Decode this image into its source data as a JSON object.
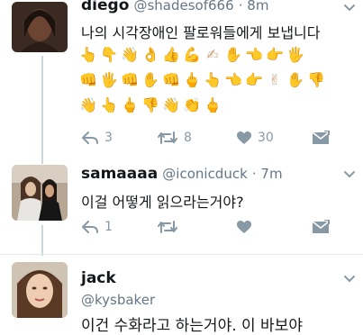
{
  "tweets": [
    {
      "name": "diego",
      "handle": "@shadesof666",
      "time": "· 8m",
      "text": "나의 시각장애인 팔로워들에게 보냅니다",
      "emoji_rows": [
        [
          "👆",
          "👇",
          "👋",
          "👌",
          "👍",
          "💪",
          "✍",
          "✋",
          "👈",
          "👉",
          "🖐"
        ],
        [
          "👊",
          "🖐",
          "👊",
          "✋",
          "👊",
          "🖕",
          "👆",
          "👈",
          "👉",
          "✌",
          "✋",
          "👎"
        ],
        [
          "👋",
          "👆",
          "🖕",
          "👎",
          "👋",
          "👏",
          "🖕"
        ]
      ],
      "stats": {
        "replies": "3",
        "retweets": "8",
        "likes": "30"
      }
    },
    {
      "name": "samaaaa",
      "handle": "@iconicduck",
      "time": "· 7m",
      "text": "이걸 어떻게 읽으라는거야?",
      "stats": {
        "replies": "1",
        "retweets": "",
        "likes": ""
      }
    },
    {
      "name": "jack",
      "handle": "@kysbaker",
      "time": "",
      "text": "이건 수화라고 하는거야. 이 바보야"
    }
  ],
  "icons": {
    "reply": "reply-icon",
    "retweet": "retweet-icon",
    "like": "heart-icon",
    "dm": "envelope-icon",
    "more": "chevron-down-icon"
  },
  "colors": {
    "text": "#14171a",
    "muted": "#8899a6",
    "line": "#ccd6dd",
    "skin": "#c9a27e"
  }
}
